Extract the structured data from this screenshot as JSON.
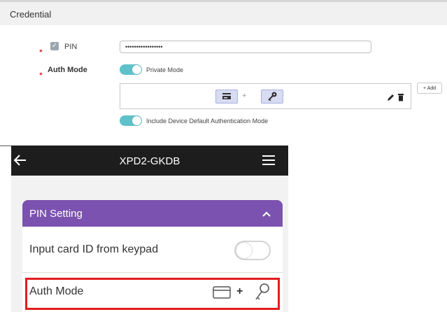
{
  "credential": {
    "title": "Credential",
    "pin_label": "PIN",
    "pin_value": "•••••••••••••••••",
    "auth_mode_label": "Auth Mode",
    "private_mode_label": "Private Mode",
    "plus_symbol": "+",
    "add_button": "+ Add",
    "include_default_label": "Include Device Default Authentication Mode"
  },
  "device": {
    "title": "XPD2-GKDB",
    "section_title": "PIN Setting",
    "input_card_label": "Input card ID from keypad",
    "auth_mode_label": "Auth Mode",
    "plus_symbol": "+"
  },
  "colors": {
    "accent_teal": "#5fc1c9",
    "purple_header": "#7c52b0",
    "highlight_red": "#e21d1d"
  },
  "icons": [
    "checkbox-check-icon",
    "card-icon",
    "key-icon",
    "pencil-icon",
    "trash-icon",
    "back-arrow-icon",
    "menu-icon",
    "chevron-up-icon"
  ]
}
